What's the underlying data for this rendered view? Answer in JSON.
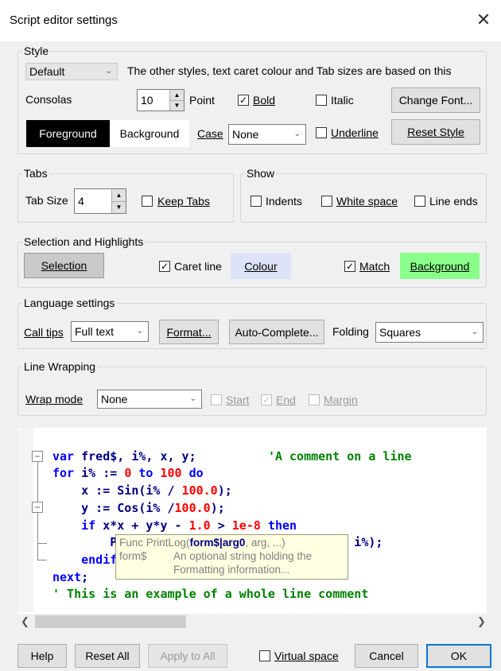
{
  "window": {
    "title": "Script editor settings",
    "close_glyph": "✕"
  },
  "style_group": {
    "label": "Style",
    "style_select": "Default",
    "info_text": "The other styles, text caret colour and Tab sizes are based on this",
    "font_name": "Consolas",
    "font_size": "10",
    "point_label": "Point",
    "bold_label": "Bold",
    "bold_checked": true,
    "italic_label": "Italic",
    "italic_checked": false,
    "change_font_label": "Change Font...",
    "foreground_label": "Foreground",
    "background_label": "Background",
    "case_label": "Case",
    "case_value": "None",
    "underline_label": "Underline",
    "underline_checked": false,
    "reset_style_label": "Reset Style"
  },
  "tabs_group": {
    "label": "Tabs",
    "tab_size_label": "Tab Size",
    "tab_size_value": "4",
    "keep_tabs_label": "Keep Tabs",
    "keep_tabs_checked": false
  },
  "show_group": {
    "label": "Show",
    "indents_label": "Indents",
    "white_space_label": "White space",
    "line_ends_label": "Line ends"
  },
  "selection_group": {
    "label": "Selection and Highlights",
    "selection_button": "Selection",
    "caret_line_label": "Caret line",
    "caret_line_checked": true,
    "colour_button": "Colour",
    "match_label": "Match",
    "match_checked": true,
    "background_button": "Background",
    "colour_bg": "#dde3f7",
    "background_bg": "#8aff8a"
  },
  "language_group": {
    "label": "Language settings",
    "call_tips_label": "Call tips",
    "call_tips_value": "Full text",
    "format_button": "Format...",
    "autocomplete_button": "Auto-Complete...",
    "folding_label": "Folding",
    "folding_value": "Squares"
  },
  "wrap_group": {
    "label": "Line Wrapping",
    "wrap_mode_label": "Wrap mode",
    "wrap_mode_value": "None",
    "start_label": "Start",
    "end_label": "End",
    "margin_label": "Margin"
  },
  "tooltip": {
    "line1_prefix": "Func PrintLog(",
    "line1_bold": "form$|arg0",
    "line1_suffix": ", arg, ...)",
    "param_name": "form$",
    "param_desc_1": "An optional string holding the",
    "param_desc_2": "Formatting information..."
  },
  "footer": {
    "help": "Help",
    "reset_all": "Reset All",
    "apply_to_all": "Apply to All",
    "virtual_space": "Virtual space",
    "cancel": "Cancel",
    "ok": "OK"
  },
  "colors": {
    "keyword": "#0000ff",
    "number": "#ff0000",
    "string": "#ff0000",
    "comment": "#008000",
    "identifier": "#000080"
  },
  "icons": {
    "close": "close-icon",
    "chevron": "chevron-down-icon",
    "checkmark": "checkmark-icon",
    "fold": "fold-minus-icon",
    "scroll_left": "scroll-left-icon",
    "scroll_right": "scroll-right-icon"
  }
}
